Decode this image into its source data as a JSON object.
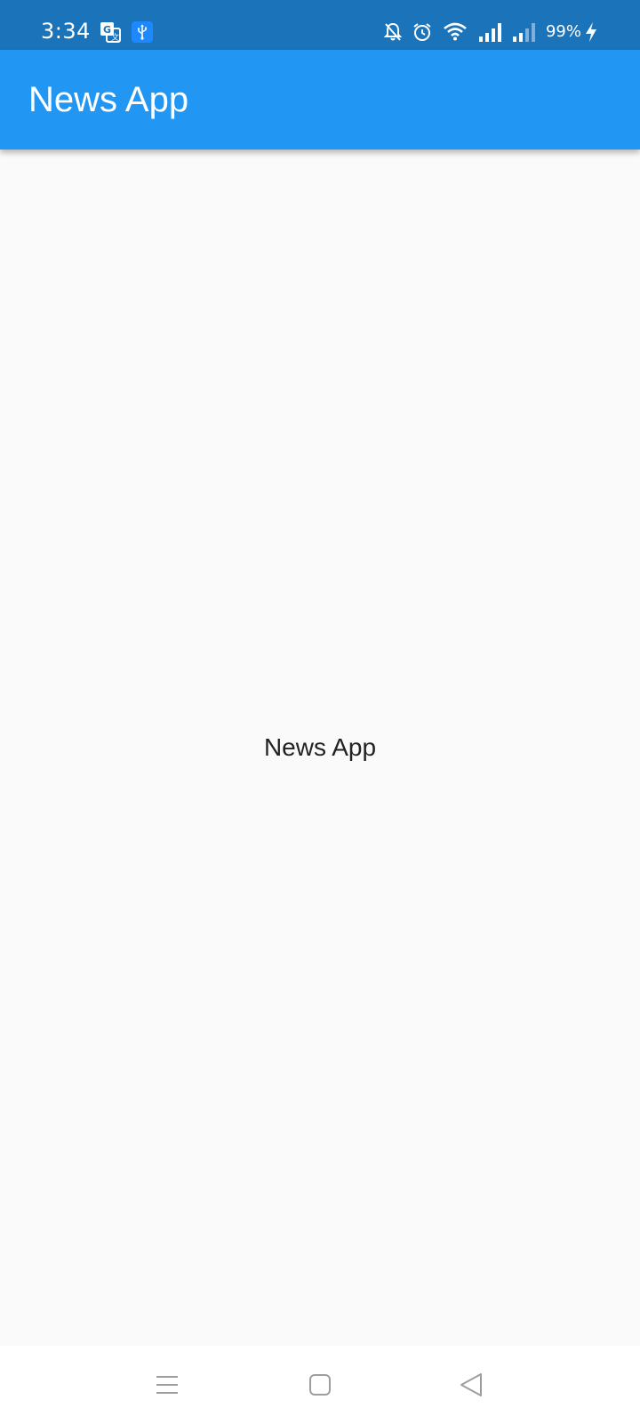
{
  "status_bar": {
    "time": "3:34",
    "battery": "99%",
    "left_icons": [
      "translate-icon",
      "usb-icon"
    ],
    "right_icons": [
      "bell-off-icon",
      "alarm-icon",
      "wifi-icon",
      "signal-icon",
      "signal-weak-icon",
      "battery-charging-icon"
    ],
    "background": "#1b73ba"
  },
  "app_bar": {
    "title": "News App",
    "background": "#2196f3"
  },
  "body": {
    "center_text": "News App",
    "background": "#fafafa"
  },
  "nav_bar": {
    "buttons": [
      "menu-icon",
      "home-icon",
      "back-icon"
    ]
  }
}
